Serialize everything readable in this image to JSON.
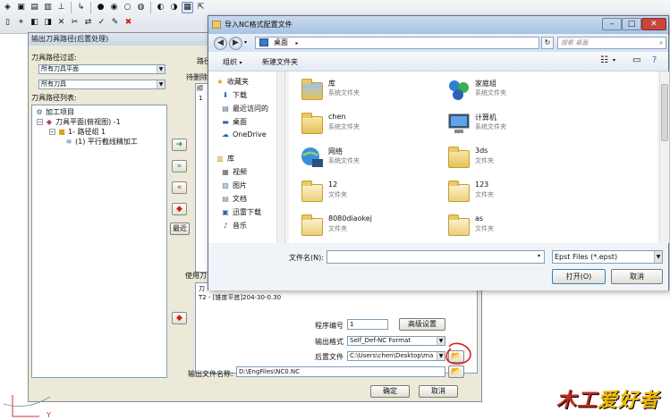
{
  "output_dialog": {
    "title": "输出刀具路径(后置处理)",
    "filter_label": "刀具路径过滤:",
    "filter_plane": "所有刀具平面",
    "filter_tool": "所有刀具",
    "list_label": "刀具路径列表:",
    "tree": {
      "root": "加工项目",
      "plane": "刀具平面(俯视图) -1",
      "group": "1- 路径组 1",
      "path": "(1) 平行截线精加工"
    },
    "side_label_1": "路径输",
    "side_label_2": "待删除",
    "col_header_1": "顺",
    "col_value_1": "1",
    "recent_button": "最近",
    "use_tool_label": "使用刀",
    "col_header_2": "刀",
    "tool_row": "T2 - [锥度平底]204-30-0.30",
    "program_no_label": "程序编号",
    "program_no_value": "1",
    "advanced_button": "高级设置",
    "output_format_label": "输出格式",
    "output_format_value": "Self_Def-NC Format",
    "post_file_label": "后置文件",
    "post_file_value": "C:\\Users\\chen\\Desktop\\ma",
    "output_name_label": "输出文件名称:",
    "output_name_value": "D:\\EngFiles\\NC0.NC",
    "ok_button": "确定",
    "cancel_button": "取消",
    "axis_y": "Y"
  },
  "file_dialog": {
    "title": "导入NC格式配置文件",
    "address": "桌面",
    "search_placeholder": "搜索 桌面",
    "organize": "组织",
    "new_folder": "新建文件夹",
    "nav_items": [
      {
        "label": "收藏夹",
        "icon": "star-icon"
      },
      {
        "label": "下载",
        "icon": "download-icon"
      },
      {
        "label": "最近访问的",
        "icon": "recent-icon"
      },
      {
        "label": "桌面",
        "icon": "desktop-icon"
      },
      {
        "label": "OneDrive",
        "icon": "cloud-icon"
      },
      {
        "label": "库",
        "icon": "library-icon"
      },
      {
        "label": "视频",
        "icon": "video-icon"
      },
      {
        "label": "图片",
        "icon": "picture-icon"
      },
      {
        "label": "文档",
        "icon": "document-icon"
      },
      {
        "label": "迅雷下载",
        "icon": "thunder-icon"
      },
      {
        "label": "音乐",
        "icon": "music-icon"
      }
    ],
    "files": [
      {
        "name": "库",
        "type": "系统文件夹",
        "icon": "library-icon"
      },
      {
        "name": "家庭组",
        "type": "系统文件夹",
        "icon": "homegroup-icon"
      },
      {
        "name": "chen",
        "type": "系统文件夹",
        "icon": "user-folder-icon"
      },
      {
        "name": "计算机",
        "type": "系统文件夹",
        "icon": "computer-icon"
      },
      {
        "name": "网络",
        "type": "系统文件夹",
        "icon": "network-icon"
      },
      {
        "name": "3ds",
        "type": "文件夹",
        "icon": "folder-icon"
      },
      {
        "name": "12",
        "type": "文件夹",
        "icon": "folder-icon"
      },
      {
        "name": "123",
        "type": "文件夹",
        "icon": "folder-icon"
      },
      {
        "name": "8080diaokej",
        "type": "文件夹",
        "icon": "folder-icon"
      },
      {
        "name": "as",
        "type": "文件夹",
        "icon": "folder-icon"
      }
    ],
    "filename_label": "文件名(N):",
    "filename_value": "",
    "filetype_value": "Epst Files (*.epst)",
    "open_button": "打开(O)",
    "cancel_button": "取消"
  },
  "watermark": {
    "part1": "木工",
    "part2": "爱好者"
  },
  "colors": {
    "title_blue": "#a9c3e3",
    "dialog_bg": "#ece9d8",
    "annotation_red": "#d21f1f"
  }
}
